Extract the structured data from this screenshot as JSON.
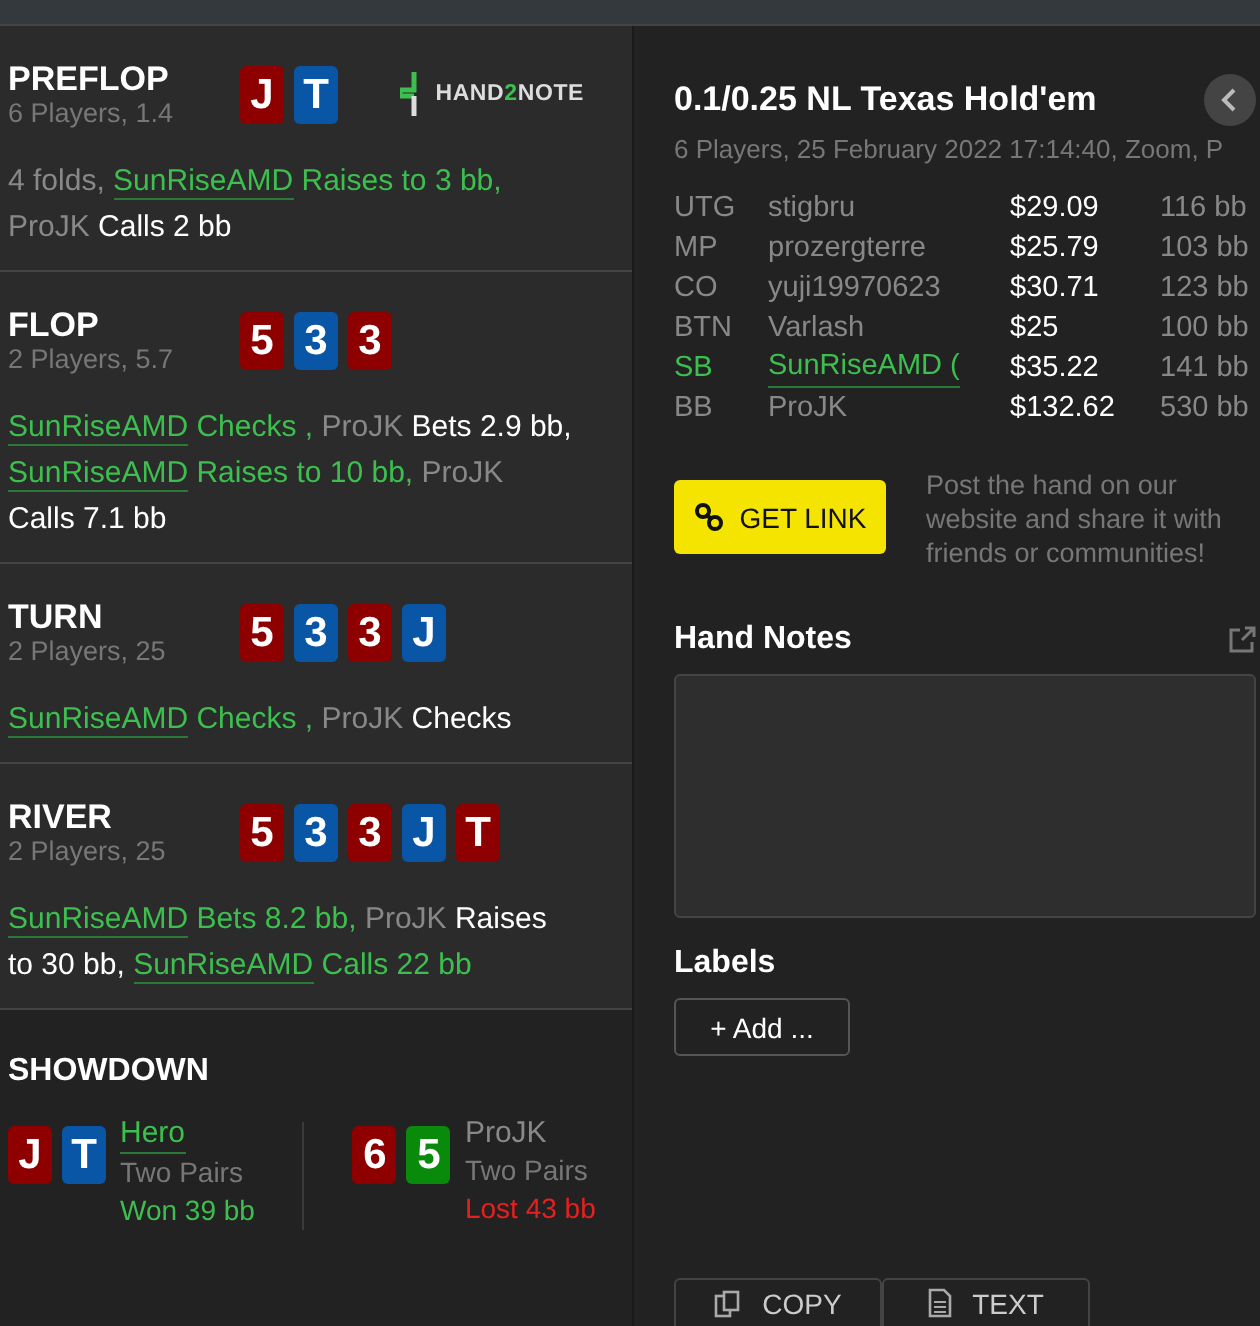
{
  "logo": {
    "parts": [
      "HAND",
      "2",
      "NOTE"
    ]
  },
  "streets": [
    {
      "name": "PREFLOP",
      "info": "6 Players, 1.4",
      "cards": [
        {
          "rank": "J",
          "color": "#8e0000"
        },
        {
          "rank": "T",
          "color": "#0a56a6"
        }
      ],
      "actions": [
        {
          "text": "4 folds,",
          "kind": "plain"
        },
        {
          "text": "SunRiseAMD",
          "kind": "hero-name"
        },
        {
          "text": "Raises to 3 bb,",
          "kind": "hero-act"
        },
        {
          "text": "ProJK",
          "kind": "name"
        },
        {
          "text": "Calls 2 bb",
          "kind": "act"
        }
      ]
    },
    {
      "name": "FLOP",
      "info": "2 Players, 5.7",
      "cards": [
        {
          "rank": "5",
          "color": "#8e0000"
        },
        {
          "rank": "3",
          "color": "#0a56a6"
        },
        {
          "rank": "3",
          "color": "#8e0000"
        }
      ],
      "actions": [
        {
          "text": "SunRiseAMD",
          "kind": "hero-name"
        },
        {
          "text": "Checks ,",
          "kind": "hero-act"
        },
        {
          "text": "ProJK",
          "kind": "name"
        },
        {
          "text": "Bets 2.9 bb,",
          "kind": "act"
        },
        {
          "text": "SunRiseAMD",
          "kind": "hero-name"
        },
        {
          "text": "Raises to 10 bb,",
          "kind": "hero-act"
        },
        {
          "text": "ProJK",
          "kind": "name"
        },
        {
          "text": "Calls 7.1 bb",
          "kind": "act"
        }
      ]
    },
    {
      "name": "TURN",
      "info": "2 Players, 25",
      "cards": [
        {
          "rank": "5",
          "color": "#8e0000"
        },
        {
          "rank": "3",
          "color": "#0a56a6"
        },
        {
          "rank": "3",
          "color": "#8e0000"
        },
        {
          "rank": "J",
          "color": "#0a56a6"
        }
      ],
      "actions": [
        {
          "text": "SunRiseAMD",
          "kind": "hero-name"
        },
        {
          "text": "Checks ,",
          "kind": "hero-act"
        },
        {
          "text": "ProJK",
          "kind": "name"
        },
        {
          "text": "Checks",
          "kind": "act"
        }
      ]
    },
    {
      "name": "RIVER",
      "info": "2 Players, 25",
      "cards": [
        {
          "rank": "5",
          "color": "#8e0000"
        },
        {
          "rank": "3",
          "color": "#0a56a6"
        },
        {
          "rank": "3",
          "color": "#8e0000"
        },
        {
          "rank": "J",
          "color": "#0a56a6"
        },
        {
          "rank": "T",
          "color": "#8e0000"
        }
      ],
      "actions": [
        {
          "text": "SunRiseAMD",
          "kind": "hero-name"
        },
        {
          "text": "Bets 8.2 bb,",
          "kind": "hero-act"
        },
        {
          "text": "ProJK",
          "kind": "name"
        },
        {
          "text": "Raises to 30 bb,",
          "kind": "act"
        },
        {
          "text": "SunRiseAMD",
          "kind": "hero-name"
        },
        {
          "text": "Calls 22 bb",
          "kind": "hero-act"
        }
      ]
    }
  ],
  "showdown": {
    "title": "SHOWDOWN",
    "hands": [
      {
        "player": "Hero",
        "hero": true,
        "hand": "Two Pairs",
        "result": "Won 39 bb",
        "won": true,
        "cards": [
          {
            "rank": "J",
            "color": "#8e0000"
          },
          {
            "rank": "T",
            "color": "#0a56a6"
          }
        ]
      },
      {
        "player": "ProJK",
        "hero": false,
        "hand": "Two Pairs",
        "result": "Lost 43 bb",
        "won": false,
        "cards": [
          {
            "rank": "6",
            "color": "#8e0000"
          },
          {
            "rank": "5",
            "color": "#0a8a0a"
          }
        ]
      }
    ]
  },
  "game": {
    "title": "0.1/0.25 NL Texas Hold'em",
    "subtitle": "6 Players, 25 February 2022 17:14:40, Zoom, P"
  },
  "players": [
    {
      "position": "UTG",
      "name": "stigbru",
      "stack": "$29.09",
      "bb": "116 bb",
      "hero": false
    },
    {
      "position": "MP",
      "name": "prozergterre",
      "stack": "$25.79",
      "bb": "103 bb",
      "hero": false
    },
    {
      "position": "CO",
      "name": "yuji19970623",
      "stack": "$30.71",
      "bb": "123 bb",
      "hero": false
    },
    {
      "position": "BTN",
      "name": "Varlash",
      "stack": "$25",
      "bb": "100 bb",
      "hero": false
    },
    {
      "position": "SB",
      "name": "SunRiseAMD (",
      "stack": "$35.22",
      "bb": "141 bb",
      "hero": true
    },
    {
      "position": "BB",
      "name": "ProJK",
      "stack": "$132.62",
      "bb": "530 bb",
      "hero": false
    }
  ],
  "share": {
    "button": "GET LINK",
    "text": "Post the hand on our website and share it with friends or communities!"
  },
  "notes": {
    "title": "Hand Notes"
  },
  "labels": {
    "title": "Labels",
    "add": "+ Add ..."
  },
  "bottom_buttons": [
    {
      "label": "COPY",
      "kind": "copy"
    },
    {
      "label": "TEXT",
      "kind": "text"
    }
  ]
}
